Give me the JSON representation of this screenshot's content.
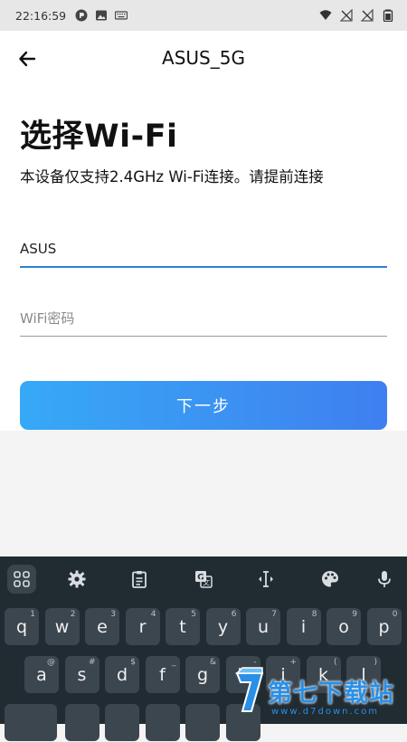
{
  "status_bar": {
    "time": "22:16:59",
    "left_icons": [
      "circle-logo-icon",
      "image-icon",
      "keyboard-icon"
    ],
    "right_icons": [
      "wifi-icon",
      "no-signal-icon",
      "no-signal-icon",
      "battery-icon"
    ]
  },
  "topbar": {
    "title": "ASUS_5G",
    "back_icon": "arrow-left-icon"
  },
  "content": {
    "heading": "选择Wi-Fi",
    "subtext": "本设备仅支持2.4GHz Wi-Fi连接。请提前连接",
    "ssid_value": "ASUS",
    "password_placeholder": "WiFi密码",
    "next_button": "下一步"
  },
  "keyboard": {
    "toolbar_icons": [
      "apps-grid-icon",
      "settings-gear-icon",
      "clipboard-icon",
      "translate-icon",
      "text-cursor-icon",
      "palette-icon",
      "microphone-icon"
    ],
    "row1": [
      {
        "k": "q",
        "h": "1"
      },
      {
        "k": "w",
        "h": "2"
      },
      {
        "k": "e",
        "h": "3"
      },
      {
        "k": "r",
        "h": "4"
      },
      {
        "k": "t",
        "h": "5"
      },
      {
        "k": "y",
        "h": "6"
      },
      {
        "k": "u",
        "h": "7"
      },
      {
        "k": "i",
        "h": "8"
      },
      {
        "k": "o",
        "h": "9"
      },
      {
        "k": "p",
        "h": "0"
      }
    ],
    "row2": [
      {
        "k": "a",
        "h": "@"
      },
      {
        "k": "s",
        "h": "#"
      },
      {
        "k": "d",
        "h": "$"
      },
      {
        "k": "f",
        "h": "_"
      },
      {
        "k": "g",
        "h": "&"
      },
      {
        "k": "h",
        "h": "-"
      },
      {
        "k": "j",
        "h": "+"
      },
      {
        "k": "k",
        "h": "("
      },
      {
        "k": "l",
        "h": ")"
      }
    ]
  },
  "watermark": {
    "text": "第七下载站",
    "url": "www.d7down.com"
  }
}
